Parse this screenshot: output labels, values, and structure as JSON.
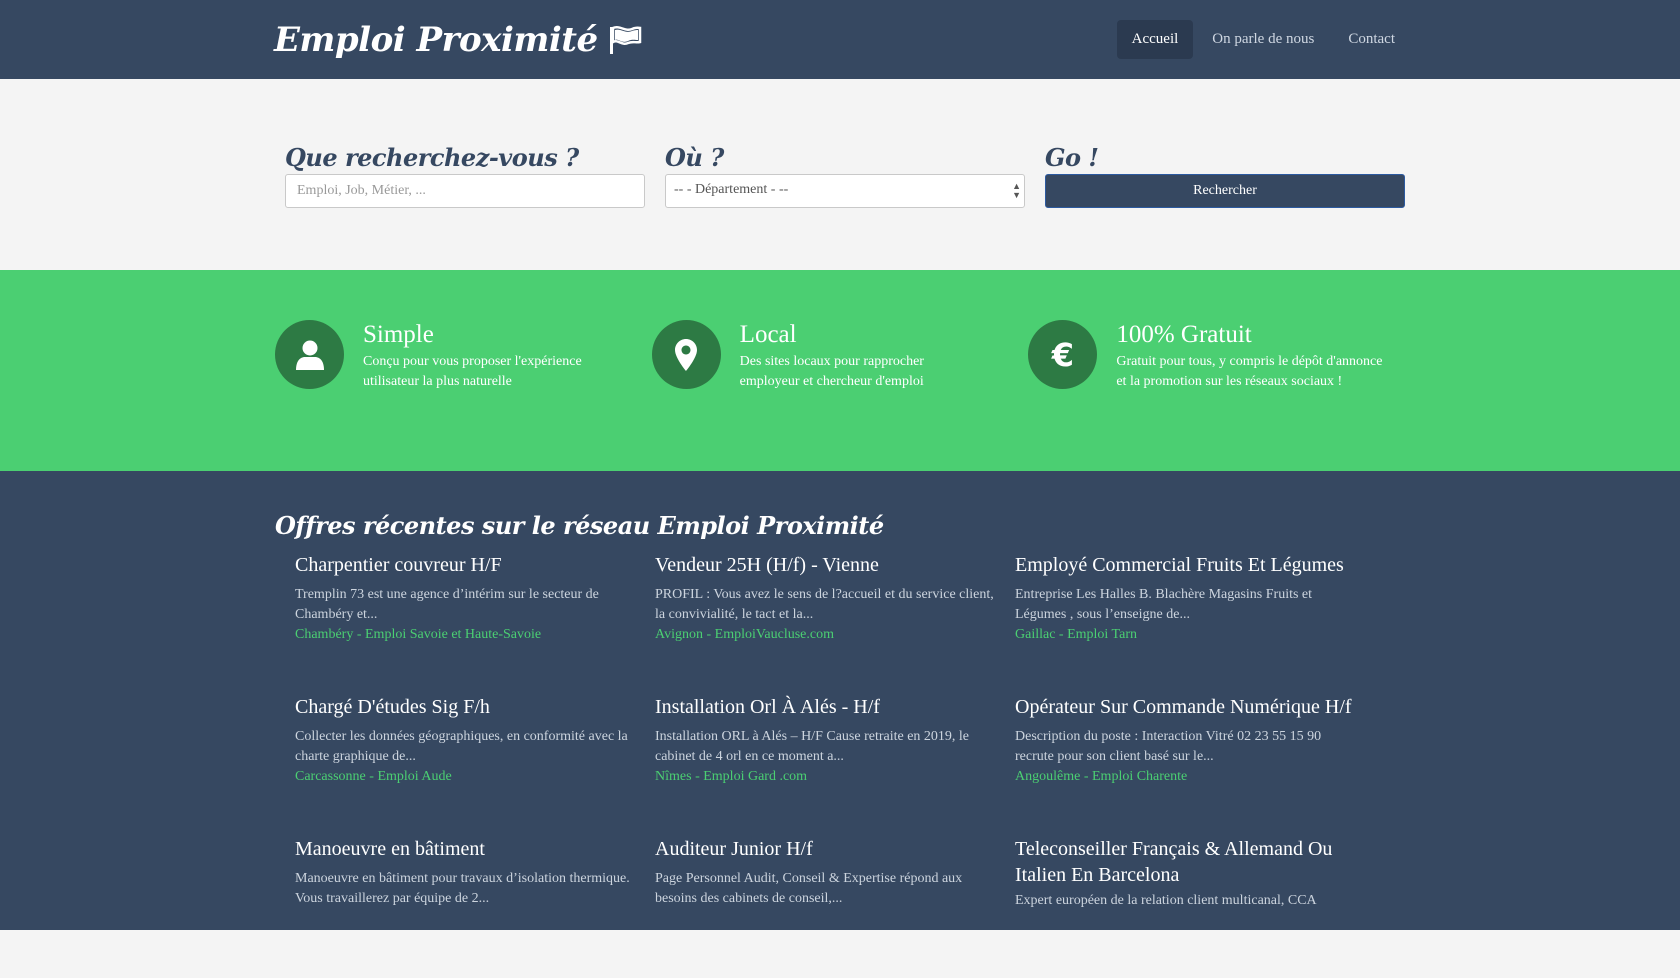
{
  "header": {
    "brand": "Emploi Proximité",
    "nav": [
      {
        "label": "Accueil",
        "active": true
      },
      {
        "label": "On parle de nous",
        "active": false
      },
      {
        "label": "Contact",
        "active": false
      }
    ]
  },
  "search": {
    "what_label": "Que recherchez-vous ?",
    "what_placeholder": "Emploi, Job, Métier, ...",
    "where_label": "Où ?",
    "where_selected": "-- - Département - --",
    "go_label": "Go !",
    "button_label": "Rechercher"
  },
  "features": [
    {
      "icon": "user-icon",
      "title": "Simple",
      "text": "Conçu pour vous proposer l'expérience utilisateur la plus naturelle"
    },
    {
      "icon": "map-marker-icon",
      "title": "Local",
      "text": "Des sites locaux pour rapprocher employeur et chercheur d'emploi"
    },
    {
      "icon": "euro-icon",
      "title": "100% Gratuit",
      "text": "Gratuit pour tous, y compris le dépôt d'annonce et la promotion sur les réseaux sociaux !"
    }
  ],
  "offers": {
    "heading": "Offres récentes sur le réseau Emploi Proximité",
    "jobs": [
      {
        "title": "Charpentier couvreur H/F",
        "desc": "Tremplin 73 est une agence d’intérim sur le secteur de Chambéry et...",
        "city": "Chambéry",
        "site": "Emploi Savoie et Haute-Savoie"
      },
      {
        "title": "Vendeur 25H (H/f) - Vienne",
        "desc": "PROFIL : Vous avez le sens de l?accueil et du service client, la convivialité, le tact et la...",
        "city": "Avignon",
        "site": "EmploiVaucluse.com"
      },
      {
        "title": "Employé Commercial Fruits Et Légumes",
        "desc": "Entreprise Les Halles B. Blachère Magasins Fruits et Légumes , sous l’enseigne de...",
        "city": "Gaillac",
        "site": "Emploi Tarn"
      },
      {
        "title": "Chargé D'études Sig F/h",
        "desc": "Collecter les données géographiques, en conformité avec la charte graphique de...",
        "city": "Carcassonne",
        "site": "Emploi Aude"
      },
      {
        "title": "Installation Orl À Alés - H/f",
        "desc": "Installation ORL à Alés – H/F Cause retraite en 2019, le cabinet de 4 orl en ce moment a...",
        "city": "Nîmes",
        "site": "Emploi Gard .com"
      },
      {
        "title": "Opérateur Sur Commande Numérique H/f",
        "desc": "Description du poste : Interaction Vitré 02 23 55 15 90 recrute pour son client basé sur le...",
        "city": "Angoulême",
        "site": "Emploi Charente"
      },
      {
        "title": "Manoeuvre en bâtiment",
        "desc": "Manoeuvre en bâtiment pour travaux d’isolation thermique. Vous travaillerez par équipe de 2...",
        "city": "",
        "site": ""
      },
      {
        "title": "Auditeur Junior H/f",
        "desc": "Page Personnel Audit, Conseil & Expertise répond aux besoins des cabinets de conseil,...",
        "city": "",
        "site": ""
      },
      {
        "title": "Teleconseiller Français & Allemand Ou Italien En Barcelona",
        "desc": "Expert européen de la relation client multicanal, CCA",
        "city": "",
        "site": ""
      }
    ]
  }
}
